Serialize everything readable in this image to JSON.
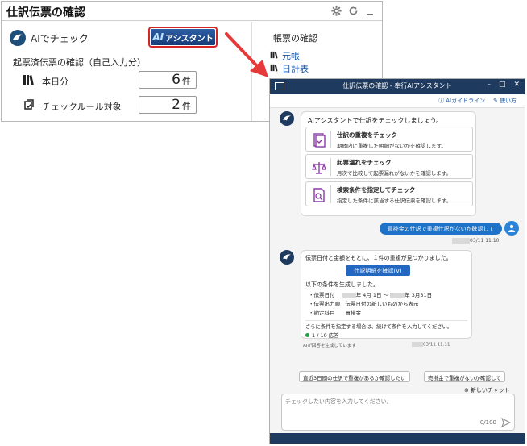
{
  "panel1": {
    "title": "仕訳伝票の確認",
    "ai_check_label": "AIでチェック",
    "ai_button": {
      "prefix": "AI",
      "label": "アシスタント"
    },
    "section_title": "起票済伝票の確認（自己入力分）",
    "rows": [
      {
        "label": "本日分",
        "count": "6",
        "unit": "件"
      },
      {
        "label": "チェックルール対象",
        "count": "2",
        "unit": "件"
      }
    ],
    "ledger": {
      "title": "帳票の確認",
      "links": [
        "元帳",
        "日計表"
      ]
    }
  },
  "panel2": {
    "title": "仕訳伝票の確認 - 奉行AIアシスタント",
    "links": {
      "guide": "AIガイドライン",
      "howto": "使い方"
    },
    "intro": "AIアシスタントで仕訳をチェックしましょう。",
    "options": [
      {
        "title": "仕訳の重複をチェック",
        "desc": "期間内に重複した明細がないかを確認します。"
      },
      {
        "title": "起票漏れをチェック",
        "desc": "月次で比較して起票漏れがないかを確認します。"
      },
      {
        "title": "検索条件を指定してチェック",
        "desc": "指定した条件に該当する仕訳伝票を確認します。"
      }
    ],
    "user_message": "買掛金の仕訳で重複仕訳がないか確認して",
    "user_time": "03/11 11:10",
    "reply": {
      "line1": "伝票日付と金額をもとに、１件の重複が見つかりました。",
      "button": "仕訳明細を確認(V)",
      "cond_head": "以下の条件を生成しました。",
      "cond_date_label": "・伝票日付",
      "cond_date_from": "年 4月 1日 ～",
      "cond_date_to": "年 3月31日",
      "cond_order": "・伝票出力順　伝票日付の新しいものから表示",
      "cond_account": "・勘定科目　　買掛金",
      "more": "さらに条件を指定する場合は、続けて条件を入力してください。",
      "responses": "1 / 10 応答"
    },
    "ai_note": "AIが回答を生成しています",
    "ai_time": "03/11 11:11",
    "suggestions": [
      "直近3日間の仕訳で重複があるか確認したい",
      "売掛金で重複がないか確認して"
    ],
    "new_chat": "新しいチャット",
    "input_placeholder": "チェックしたい内容を入力してください。",
    "char_count": "0/100"
  }
}
